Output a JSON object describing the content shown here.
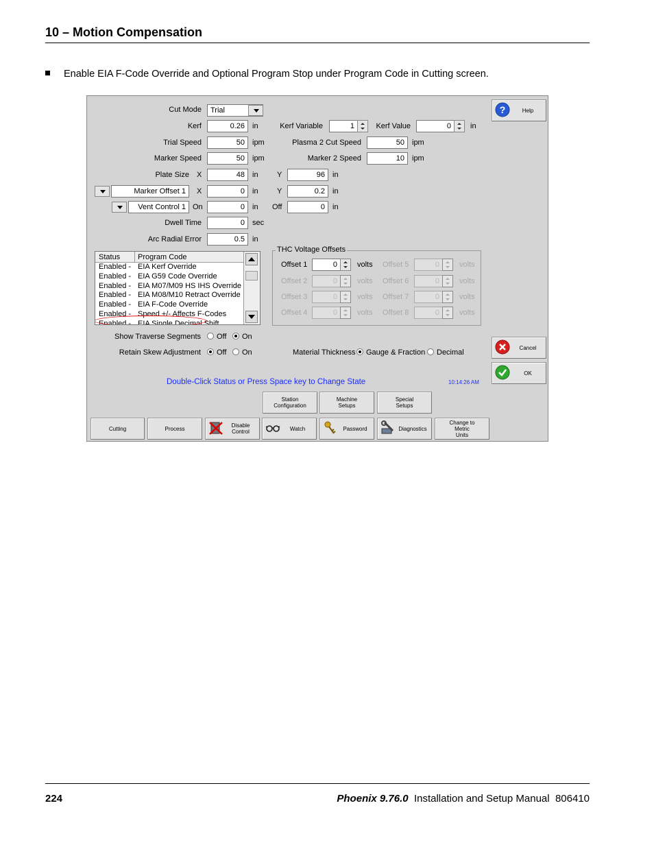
{
  "page": {
    "section_header": "10 – Motion Compensation",
    "bullet_text": "Enable EIA F-Code Override and Optional Program Stop under Program Code in Cutting screen.",
    "page_number": "224",
    "footer_product": "Phoenix 9.76.0",
    "footer_title": "Installation and Setup Manual",
    "footer_doc": "806410"
  },
  "screen": {
    "cut_mode": {
      "label": "Cut Mode",
      "value": "Trial"
    },
    "kerf": {
      "label": "Kerf",
      "value": "0.26",
      "unit": "in"
    },
    "trial_speed": {
      "label": "Trial Speed",
      "value": "50",
      "unit": "ipm"
    },
    "marker_speed": {
      "label": "Marker Speed",
      "value": "50",
      "unit": "ipm"
    },
    "plate_size": {
      "label": "Plate Size",
      "x_label": "X",
      "x_value": "48",
      "x_unit": "in",
      "y_label": "Y",
      "y_value": "96",
      "y_unit": "in"
    },
    "marker_offset": {
      "label": "Marker Offset 1",
      "x_label": "X",
      "x_value": "0",
      "x_unit": "in",
      "y_label": "Y",
      "y_value": "0.2",
      "y_unit": "in"
    },
    "vent_control": {
      "label": "Vent Control 1",
      "on_label": "On",
      "on_value": "0",
      "on_unit": "in",
      "off_label": "Off",
      "off_value": "0",
      "off_unit": "in"
    },
    "dwell_time": {
      "label": "Dwell Time",
      "value": "0",
      "unit": "sec"
    },
    "arc_radial_error": {
      "label": "Arc Radial Error",
      "value": "0.5",
      "unit": "in"
    },
    "kerf_variable": {
      "label": "Kerf Variable",
      "value": "1"
    },
    "kerf_value": {
      "label": "Kerf Value",
      "value": "0",
      "unit": "in"
    },
    "plasma2_speed": {
      "label": "Plasma 2 Cut Speed",
      "value": "50",
      "unit": "ipm"
    },
    "marker2_speed": {
      "label": "Marker 2 Speed",
      "value": "10",
      "unit": "ipm"
    },
    "program_code_list": {
      "col_status": "Status",
      "col_code": "Program Code",
      "rows": [
        {
          "status": "Enabled  -",
          "code": "EIA Kerf Override"
        },
        {
          "status": "Enabled  -",
          "code": "EIA G59 Code Override"
        },
        {
          "status": "Enabled  -",
          "code": "EIA M07/M09 HS IHS Override"
        },
        {
          "status": "Enabled  -",
          "code": "EIA M08/M10 Retract Override"
        },
        {
          "status": "Enabled  -",
          "code": "EIA F-Code Override"
        },
        {
          "status": "Enabled  -",
          "code": "Speed +/- Affects F-Codes"
        },
        {
          "status": "Enabled  -",
          "code": "EIA Single Decimal Shift"
        }
      ]
    },
    "thc": {
      "title": "THC Voltage Offsets",
      "offsets": [
        {
          "label": "Offset 1",
          "value": "0",
          "unit": "volts"
        },
        {
          "label": "Offset 2",
          "value": "0",
          "unit": "volts"
        },
        {
          "label": "Offset 3",
          "value": "0",
          "unit": "volts"
        },
        {
          "label": "Offset 4",
          "value": "0",
          "unit": "volts"
        },
        {
          "label": "Offset 5",
          "value": "0",
          "unit": "volts"
        },
        {
          "label": "Offset 6",
          "value": "0",
          "unit": "volts"
        },
        {
          "label": "Offset 7",
          "value": "0",
          "unit": "volts"
        },
        {
          "label": "Offset 8",
          "value": "0",
          "unit": "volts"
        }
      ]
    },
    "show_traverse": {
      "label": "Show Traverse Segments",
      "off": "Off",
      "on": "On",
      "selected": "On"
    },
    "retain_skew": {
      "label": "Retain Skew Adjustment",
      "off": "Off",
      "on": "On",
      "selected": "Off"
    },
    "material_thickness": {
      "label": "Material Thickness",
      "opt1": "Gauge & Fraction",
      "opt2": "Decimal",
      "selected": "Gauge & Fraction"
    },
    "hint": "Double-Click Status or Press Space key to Change State",
    "clock": "10:14:26 AM",
    "buttons": {
      "help": "Help",
      "cancel": "Cancel",
      "ok": "OK",
      "station_config": "Station Configuration",
      "machine_setups": "Machine Setups",
      "special_setups": "Special Setups",
      "cutting": "Cutting",
      "process": "Process",
      "disable_control": "Disable Control",
      "watch": "Watch",
      "password": "Password",
      "diagnostics": "Diagnostics",
      "change_metric": "Change to Metric Units"
    },
    "colors": {
      "hint_text": "#1a2dff",
      "highlight_oval": "#dd0000",
      "panel_bg": "#d4d4d4"
    }
  }
}
